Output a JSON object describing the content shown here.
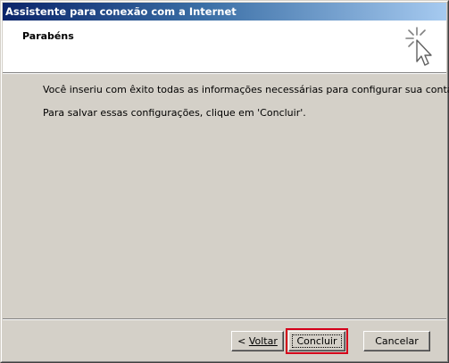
{
  "window": {
    "title": "Assistente para conexão com a Internet"
  },
  "header": {
    "title": "Parabéns",
    "icon": "wizard-cursor-sparkle-icon"
  },
  "content": {
    "line1": "Você inseriu com êxito todas as informações necessárias para configurar sua conta.",
    "line2": "Para salvar essas configurações, clique em 'Concluir'."
  },
  "buttons": {
    "back_arrow": "< ",
    "back_label": "Voltar",
    "finish_label": "Concluir",
    "cancel_label": "Cancelar"
  },
  "colors": {
    "dialog_face": "#d4d0c8",
    "titlebar_start": "#0a246a",
    "titlebar_end": "#a6caf0",
    "highlight_box": "#d4001a"
  }
}
